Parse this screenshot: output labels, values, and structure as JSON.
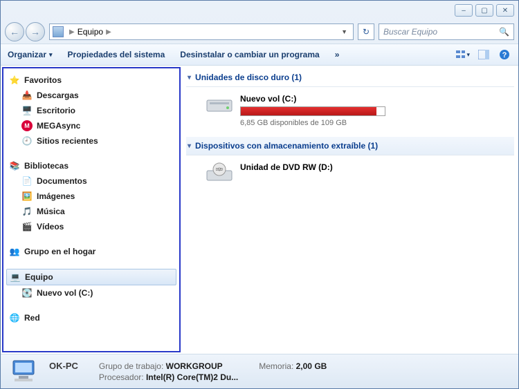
{
  "window": {
    "min": "–",
    "max": "▢",
    "close": "✕"
  },
  "nav": {
    "breadcrumb_root": "Equipo",
    "search_placeholder": "Buscar Equipo"
  },
  "toolbar": {
    "organize": "Organizar",
    "sysprops": "Propiedades del sistema",
    "uninstall": "Desinstalar o cambiar un programa",
    "more": "»"
  },
  "sidebar": {
    "favorites": {
      "label": "Favoritos",
      "items": [
        {
          "label": "Descargas",
          "icon": "download"
        },
        {
          "label": "Escritorio",
          "icon": "desktop"
        },
        {
          "label": "MEGAsync",
          "icon": "mega"
        },
        {
          "label": "Sitios recientes",
          "icon": "recent"
        }
      ]
    },
    "libraries": {
      "label": "Bibliotecas",
      "items": [
        {
          "label": "Documentos",
          "icon": "doc"
        },
        {
          "label": "Imágenes",
          "icon": "img"
        },
        {
          "label": "Música",
          "icon": "music"
        },
        {
          "label": "Vídeos",
          "icon": "video"
        }
      ]
    },
    "homegroup": {
      "label": "Grupo en el hogar"
    },
    "computer": {
      "label": "Equipo",
      "items": [
        {
          "label": "Nuevo vol (C:)",
          "icon": "drive"
        }
      ]
    },
    "network": {
      "label": "Red"
    }
  },
  "main": {
    "hdd_section": "Unidades de disco duro (1)",
    "hdd": {
      "name": "Nuevo vol (C:)",
      "sub": "6,85 GB disponibles de 109 GB",
      "fill_pct": 94
    },
    "removable_section": "Dispositivos con almacenamiento extraíble (1)",
    "dvd": {
      "name": "Unidad de DVD RW (D:)"
    }
  },
  "status": {
    "pc": "OK-PC",
    "workgroup_lbl": "Grupo de trabajo:",
    "workgroup": "WORKGROUP",
    "mem_lbl": "Memoria:",
    "mem": "2,00 GB",
    "cpu_lbl": "Procesador:",
    "cpu": "Intel(R) Core(TM)2 Du..."
  }
}
